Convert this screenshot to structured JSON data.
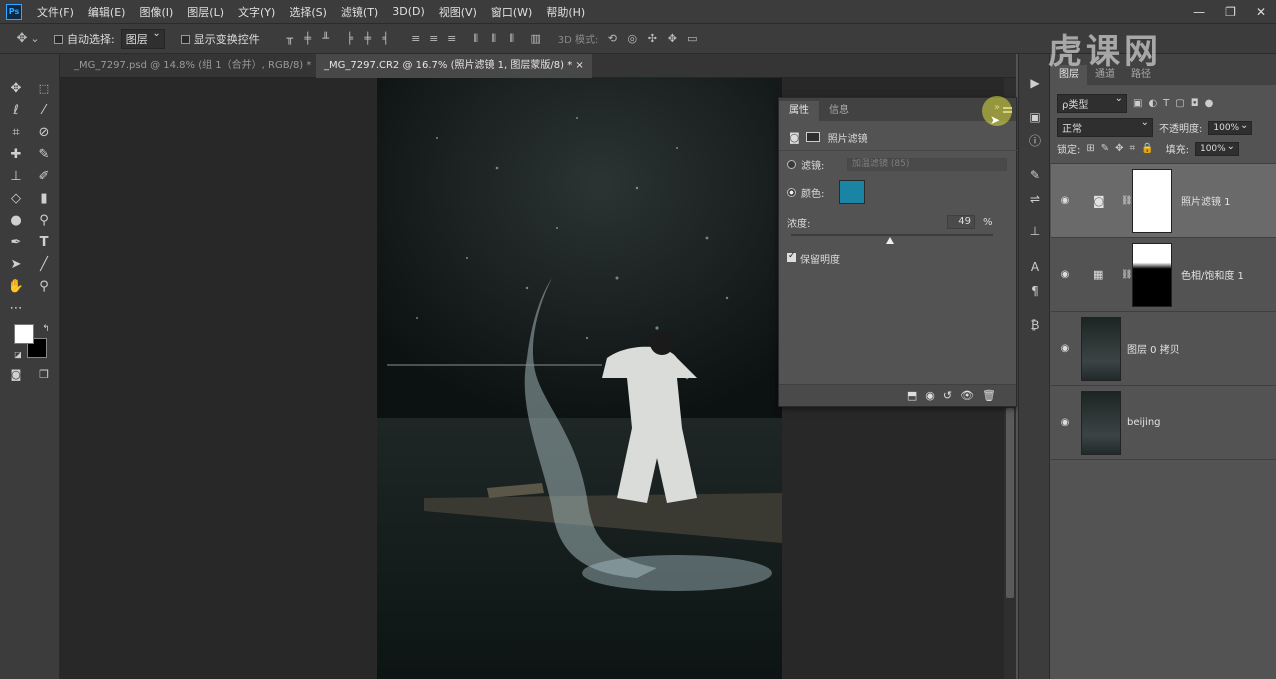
{
  "app": {
    "logo_text": "Ps"
  },
  "menubar": {
    "items": [
      "文件(F)",
      "编辑(E)",
      "图像(I)",
      "图层(L)",
      "文字(Y)",
      "选择(S)",
      "滤镜(T)",
      "3D(D)",
      "视图(V)",
      "窗口(W)",
      "帮助(H)"
    ]
  },
  "window_controls": {
    "minimize": "—",
    "restore": "❐",
    "close": "✕"
  },
  "options_bar": {
    "auto_select_label": "自动选择:",
    "auto_select_value": "图层",
    "show_transform_label": "显示变换控件",
    "mode_3d_label": "3D 模式:"
  },
  "tabs": [
    {
      "label": "_MG_7297.psd @ 14.8% (组 1（合并）, RGB/8) *",
      "close": "×"
    },
    {
      "label": "_MG_7297.CR2 @ 16.7% (照片滤镜 1, 图层蒙版/8) *",
      "close": "×"
    }
  ],
  "properties_panel": {
    "tabs": [
      "属性",
      "信息"
    ],
    "collapse_icon": "»",
    "title": "照片滤镜",
    "filter_label": "滤镜:",
    "filter_value": "加温滤镜 (85)",
    "color_label": "颜色:",
    "color_swatch": "#1a84a4",
    "density_label": "浓度:",
    "density_value": "49",
    "density_unit": "%",
    "density_fraction": 0.49,
    "preserve_luminosity_label": "保留明度",
    "preserve_luminosity_checked": true
  },
  "layers_panel": {
    "tabs": [
      "图层",
      "通道",
      "路径"
    ],
    "filter_kind": "ρ类型",
    "blend_mode": "正常",
    "opacity_label": "不透明度:",
    "opacity_value": "100%",
    "lock_label": "锁定:",
    "fill_label": "填充:",
    "fill_value": "100%",
    "layers": [
      {
        "name": "照片滤镜 1",
        "selected": true
      },
      {
        "name": "色相/饱和度 1",
        "selected": false
      },
      {
        "name": "图层 0 拷贝",
        "selected": false
      },
      {
        "name": "beijing",
        "selected": false
      }
    ]
  },
  "watermark": {
    "text": "虎课网"
  },
  "colors": {
    "menubar": "#3c3c3c",
    "panel": "#535353",
    "canvas_bg": "#282828",
    "accent": "#31a8ff",
    "highlight_cursor": "#dcdc3c"
  }
}
